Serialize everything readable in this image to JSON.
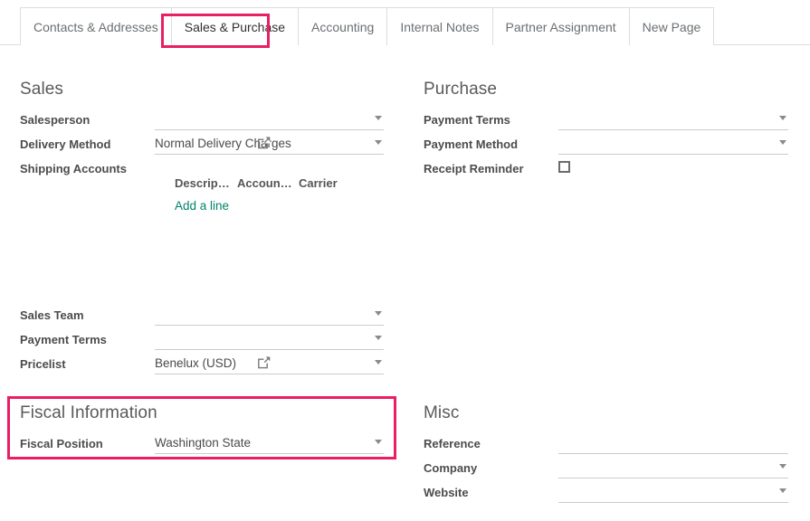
{
  "tabs": [
    {
      "label": "Contacts & Addresses",
      "active": false
    },
    {
      "label": "Sales & Purchase",
      "active": true
    },
    {
      "label": "Accounting",
      "active": false
    },
    {
      "label": "Internal Notes",
      "active": false
    },
    {
      "label": "Partner Assignment",
      "active": false
    },
    {
      "label": "New Page",
      "active": false
    }
  ],
  "highlight_color": "#e91e63",
  "sales": {
    "title": "Sales",
    "salesperson": {
      "label": "Salesperson",
      "value": ""
    },
    "delivery_method": {
      "label": "Delivery Method",
      "value": "Normal Delivery Charges"
    },
    "shipping_accounts": {
      "label": "Shipping Accounts"
    },
    "shipping_table": {
      "columns": [
        "Descrip…",
        "Accoun…",
        "Carrier"
      ],
      "add_line": "Add a line"
    },
    "sales_team": {
      "label": "Sales Team",
      "value": ""
    },
    "payment_terms": {
      "label": "Payment Terms",
      "value": ""
    },
    "pricelist": {
      "label": "Pricelist",
      "value": "Benelux (USD)"
    }
  },
  "purchase": {
    "title": "Purchase",
    "payment_terms": {
      "label": "Payment Terms",
      "value": ""
    },
    "payment_method": {
      "label": "Payment Method",
      "value": ""
    },
    "receipt_reminder": {
      "label": "Receipt Reminder",
      "checked": false
    }
  },
  "fiscal": {
    "title": "Fiscal Information",
    "fiscal_position": {
      "label": "Fiscal Position",
      "value": "Washington State"
    }
  },
  "misc": {
    "title": "Misc",
    "reference": {
      "label": "Reference",
      "value": ""
    },
    "company": {
      "label": "Company",
      "value": ""
    },
    "website": {
      "label": "Website",
      "value": ""
    }
  },
  "icons": {
    "external_link": "external-link-icon",
    "dropdown_caret": "chevron-down-icon"
  }
}
